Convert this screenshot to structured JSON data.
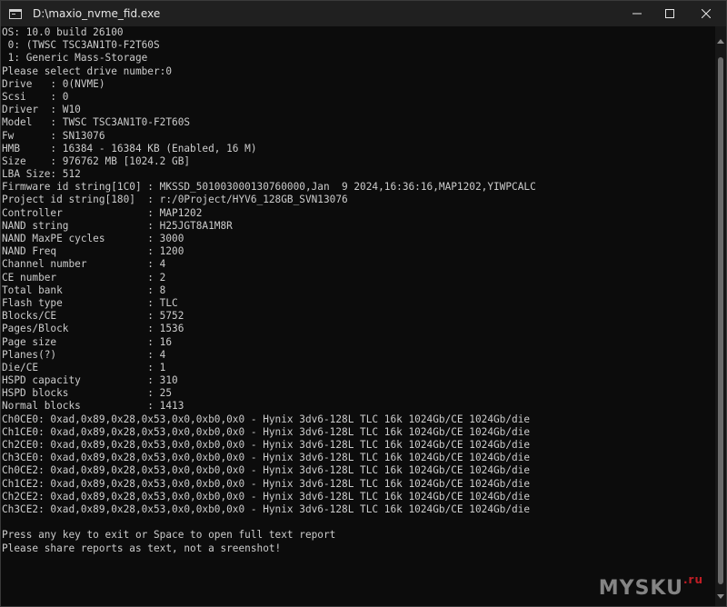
{
  "window": {
    "title": "D:\\maxio_nvme_fid.exe",
    "minimize_label": "—",
    "maximize_label": "☐",
    "close_label": "✕"
  },
  "console": {
    "lines": [
      "OS: 10.0 build 26100",
      " 0: (TWSC TSC3AN1T0-F2T60S",
      " 1: Generic Mass-Storage",
      "Please select drive number:0",
      "Drive   : 0(NVME)",
      "Scsi    : 0",
      "Driver  : W10",
      "Model   : TWSC TSC3AN1T0-F2T60S",
      "Fw      : SN13076",
      "HMB     : 16384 - 16384 KB (Enabled, 16 M)",
      "Size    : 976762 MB [1024.2 GB]",
      "LBA Size: 512",
      "Firmware id string[1C0] : MKSSD_501003000130760000,Jan  9 2024,16:36:16,MAP1202,YIWPCALC",
      "Project id string[180]  : r:/0Project/HYV6_128GB_SVN13076",
      "Controller              : MAP1202",
      "NAND string             : H25JGT8A1M8R",
      "NAND MaxPE cycles       : 3000",
      "NAND Freq               : 1200",
      "Channel number          : 4",
      "CE number               : 2",
      "Total bank              : 8",
      "Flash type              : TLC",
      "Blocks/CE               : 5752",
      "Pages/Block             : 1536",
      "Page size               : 16",
      "Planes(?)               : 4",
      "Die/CE                  : 1",
      "HSPD capacity           : 310",
      "HSPD blocks             : 25",
      "Normal blocks           : 1413",
      "Ch0CE0: 0xad,0x89,0x28,0x53,0x0,0xb0,0x0 - Hynix 3dv6-128L TLC 16k 1024Gb/CE 1024Gb/die",
      "Ch1CE0: 0xad,0x89,0x28,0x53,0x0,0xb0,0x0 - Hynix 3dv6-128L TLC 16k 1024Gb/CE 1024Gb/die",
      "Ch2CE0: 0xad,0x89,0x28,0x53,0x0,0xb0,0x0 - Hynix 3dv6-128L TLC 16k 1024Gb/CE 1024Gb/die",
      "Ch3CE0: 0xad,0x89,0x28,0x53,0x0,0xb0,0x0 - Hynix 3dv6-128L TLC 16k 1024Gb/CE 1024Gb/die",
      "Ch0CE2: 0xad,0x89,0x28,0x53,0x0,0xb0,0x0 - Hynix 3dv6-128L TLC 16k 1024Gb/CE 1024Gb/die",
      "Ch1CE2: 0xad,0x89,0x28,0x53,0x0,0xb0,0x0 - Hynix 3dv6-128L TLC 16k 1024Gb/CE 1024Gb/die",
      "Ch2CE2: 0xad,0x89,0x28,0x53,0x0,0xb0,0x0 - Hynix 3dv6-128L TLC 16k 1024Gb/CE 1024Gb/die",
      "Ch3CE2: 0xad,0x89,0x28,0x53,0x0,0xb0,0x0 - Hynix 3dv6-128L TLC 16k 1024Gb/CE 1024Gb/die",
      "",
      "Press any key to exit or Space to open full text report",
      "Please share reports as text, not a sreenshot!"
    ]
  },
  "watermark": {
    "text": "MYSKU",
    "suffix": ".ru"
  },
  "colors": {
    "background": "#0c0c0c",
    "titlebar": "#202020",
    "text": "#cccccc",
    "watermark_accent": "#e0202a"
  }
}
